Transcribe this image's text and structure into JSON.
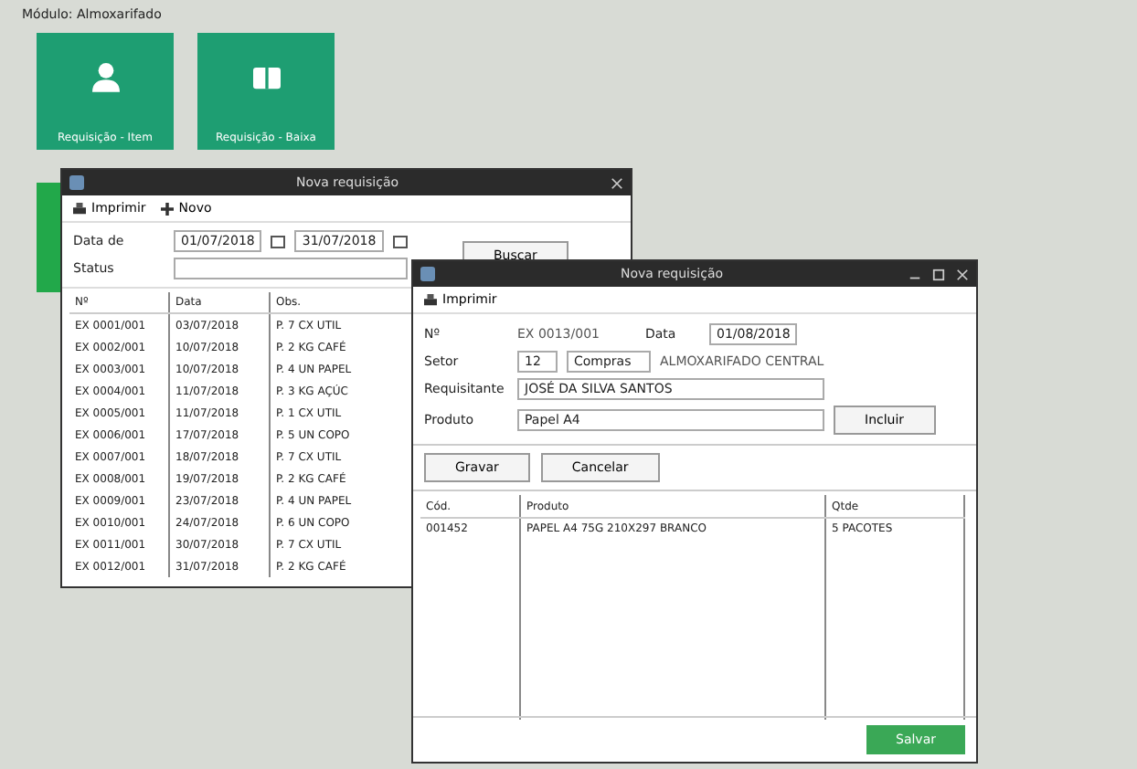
{
  "module_title": "Módulo: Almoxarifado",
  "tiles": [
    {
      "label": "Requisição - Item",
      "kind": "person"
    },
    {
      "label": "Requisição - Baixa",
      "kind": "box"
    }
  ],
  "list_window": {
    "title": "Nova requisição",
    "toolbar": [
      {
        "label": "Imprimir",
        "kind": "print"
      },
      {
        "label": "Novo",
        "kind": "add"
      }
    ],
    "filters": [
      {
        "label": "Data de",
        "from": "01/07/2018",
        "to": "31/07/2018"
      },
      {
        "label": "Status"
      }
    ],
    "search_button": "Buscar",
    "columns": [
      "Nº",
      "Data",
      "Obs."
    ],
    "rows": [
      [
        "EX 0001/001",
        "03/07/2018",
        "P. 7 CX UTIL"
      ],
      [
        "EX 0002/001",
        "10/07/2018",
        "P. 2 KG CAFÉ"
      ],
      [
        "EX 0003/001",
        "10/07/2018",
        "P. 4 UN PAPEL"
      ],
      [
        "EX 0004/001",
        "11/07/2018",
        "P. 3 KG AÇÚC"
      ],
      [
        "EX 0005/001",
        "11/07/2018",
        "P. 1 CX UTIL"
      ],
      [
        "EX 0006/001",
        "17/07/2018",
        "P. 5 UN COPO"
      ],
      [
        "EX 0007/001",
        "18/07/2018",
        "P. 7 CX UTIL"
      ],
      [
        "EX 0008/001",
        "19/07/2018",
        "P. 2 KG CAFÉ"
      ],
      [
        "EX 0009/001",
        "23/07/2018",
        "P. 4 UN PAPEL"
      ],
      [
        "EX 0010/001",
        "24/07/2018",
        "P. 6 UN COPO"
      ],
      [
        "EX 0011/001",
        "30/07/2018",
        "P. 7 CX UTIL"
      ],
      [
        "EX 0012/001",
        "31/07/2018",
        "P. 2 KG CAFÉ"
      ]
    ]
  },
  "detail_window": {
    "title": "Nova requisição",
    "toolbar": [
      {
        "label": "Imprimir",
        "kind": "print"
      }
    ],
    "fields": [
      {
        "label": "Nº",
        "value": "EX 0013/001"
      },
      {
        "label": "Data",
        "value": "01/08/2018"
      },
      {
        "label": "Setor",
        "code": "12",
        "value": "Compras",
        "extra": "ALMOXARIFADO CENTRAL"
      },
      {
        "label": "Requisitante",
        "value": "JOSÉ DA SILVA SANTOS"
      },
      {
        "label": "Produto",
        "value": "Papel A4"
      }
    ],
    "add_button": "Incluir",
    "action_buttons": [
      "Gravar",
      "Cancelar"
    ],
    "columns": [
      "Cód.",
      "Produto",
      "Qtde"
    ],
    "rows": [
      [
        "001452",
        "PAPEL A4 75G 210X297 BRANCO",
        "5 PACOTES"
      ]
    ],
    "confirm_button": "Salvar"
  }
}
